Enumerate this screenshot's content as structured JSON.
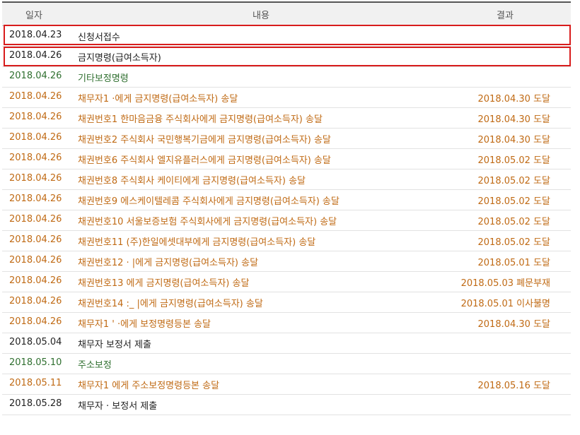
{
  "header": {
    "date": "일자",
    "content": "내용",
    "result": "결과"
  },
  "rows": [
    {
      "date": "2018.04.23",
      "content": "신청서접수",
      "result": "",
      "color": "dark"
    },
    {
      "date": "2018.04.26",
      "content": "금지명령(급여소득자)",
      "result": "",
      "color": "dark"
    },
    {
      "date": "2018.04.26",
      "content": "기타보정명령",
      "result": "",
      "color": "green"
    },
    {
      "date": "2018.04.26",
      "content": "채무자1          ·에게 금지명령(급여소득자) 송달",
      "result": "2018.04.30 도달",
      "color": "orange"
    },
    {
      "date": "2018.04.26",
      "content": "채권번호1 한마음금융 주식회사에게 금지명령(급여소득자) 송달",
      "result": "2018.04.30 도달",
      "color": "orange"
    },
    {
      "date": "2018.04.26",
      "content": "채권번호2 주식회사 국민행복기금에게 금지명령(급여소득자) 송달",
      "result": "2018.04.30 도달",
      "color": "orange"
    },
    {
      "date": "2018.04.26",
      "content": "채권번호6 주식회사 엘지유플러스에게 금지명령(급여소득자) 송달",
      "result": "2018.05.02 도달",
      "color": "orange"
    },
    {
      "date": "2018.04.26",
      "content": "채권번호8 주식회사 케이티에게 금지명령(급여소득자) 송달",
      "result": "2018.05.02 도달",
      "color": "orange"
    },
    {
      "date": "2018.04.26",
      "content": "채권번호9 에스케이텔레콤 주식회사에게 금지명령(급여소득자) 송달",
      "result": "2018.05.02 도달",
      "color": "orange"
    },
    {
      "date": "2018.04.26",
      "content": "채권번호10 서울보증보험 주식회사에게 금지명령(급여소득자) 송달",
      "result": "2018.05.02 도달",
      "color": "orange"
    },
    {
      "date": "2018.04.26",
      "content": "채권번호11 (주)한일에셋대부에게 금지명령(급여소득자) 송달",
      "result": "2018.05.02 도달",
      "color": "orange"
    },
    {
      "date": "2018.04.26",
      "content": "채권번호12 ·        |에게 금지명령(급여소득자) 송달",
      "result": "2018.05.01 도달",
      "color": "orange"
    },
    {
      "date": "2018.04.26",
      "content": "채권번호13          에게 금지명령(급여소득자) 송달",
      "result": "2018.05.03 폐문부재",
      "color": "orange"
    },
    {
      "date": "2018.04.26",
      "content": "채권번호14 :_      |에게 금지명령(급여소득자) 송달",
      "result": "2018.05.01 이사불명",
      "color": "orange"
    },
    {
      "date": "2018.04.26",
      "content": "채무자1 '        ·에게 보정명령등본 송달",
      "result": "2018.04.30 도달",
      "color": "orange"
    },
    {
      "date": "2018.05.04",
      "content": "채무자           보정서 제출",
      "result": "",
      "color": "dark"
    },
    {
      "date": "2018.05.10",
      "content": "주소보정",
      "result": "",
      "color": "green"
    },
    {
      "date": "2018.05.11",
      "content": "채무자1          에게 주소보정명령등본 송달",
      "result": "2018.05.16 도달",
      "color": "orange"
    },
    {
      "date": "2018.05.28",
      "content": "채무자         · 보정서 제출",
      "result": "",
      "color": "dark"
    }
  ],
  "colors": {
    "dark": "#222222",
    "green": "#2f6f2f",
    "orange": "#c06a14",
    "highlight": "#d81c1c"
  }
}
